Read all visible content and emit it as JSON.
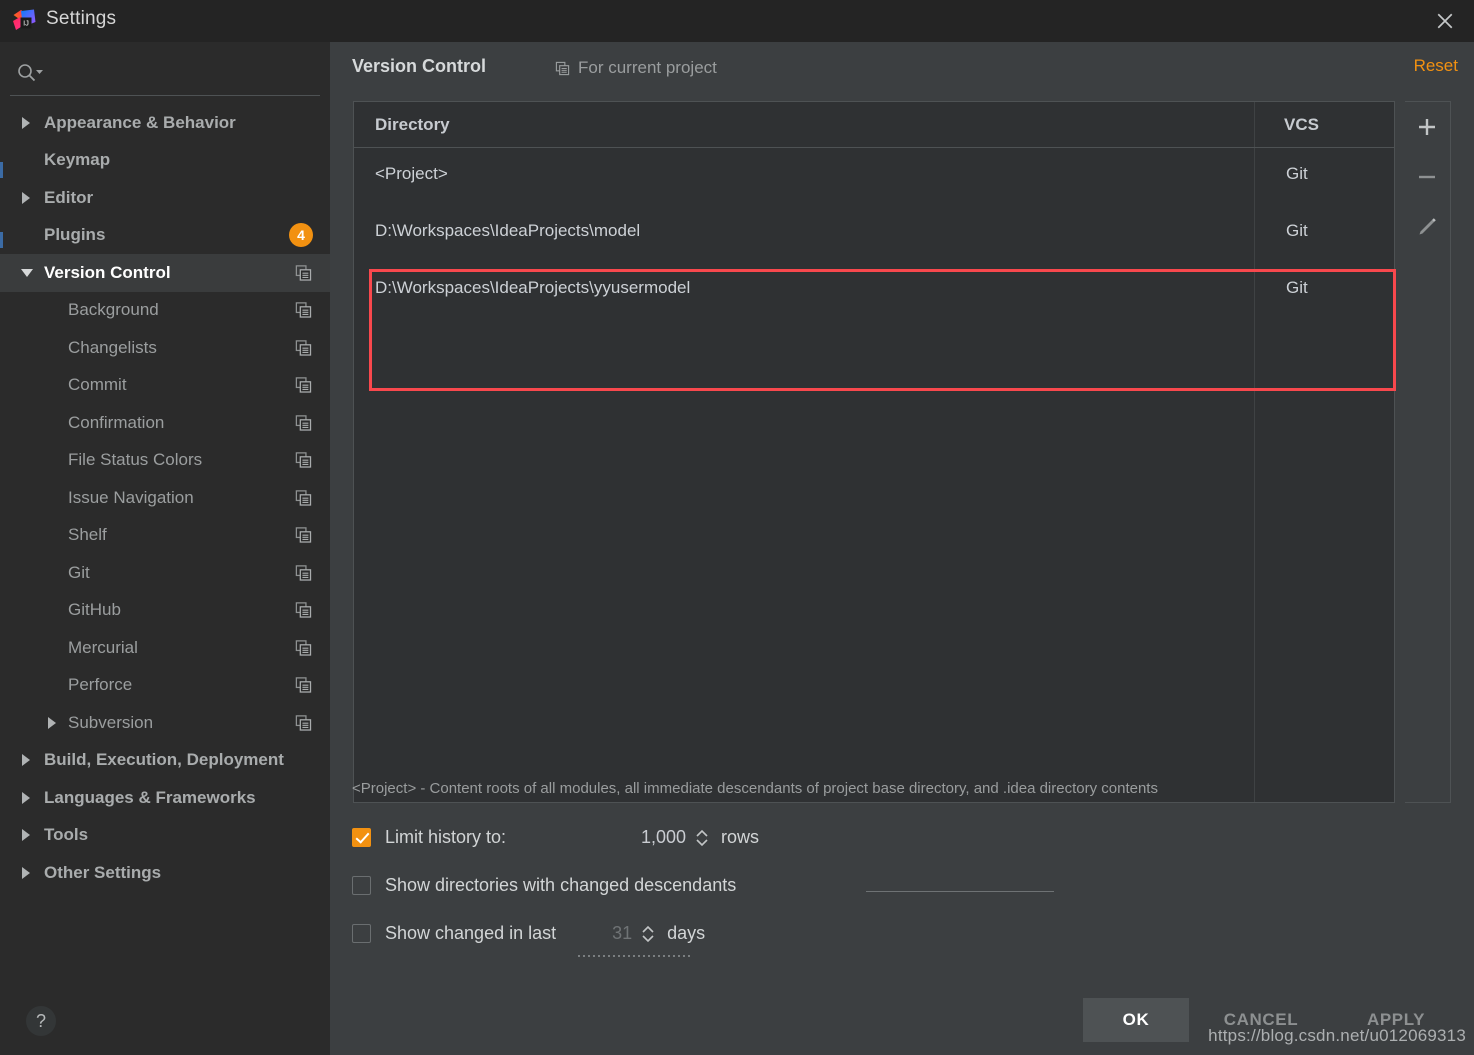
{
  "window": {
    "title": "Settings",
    "logo_icon": "intellij-idea-logo",
    "close_icon": "close-icon"
  },
  "sidebar": {
    "search": {
      "placeholder": "",
      "value": "",
      "icon": "search-icon",
      "dropdown_icon": "chevron-down-icon"
    },
    "items": [
      {
        "label": "Appearance & Behavior",
        "arrow": "right",
        "indent": 44,
        "bold": true,
        "copy_icon": false,
        "selected": false
      },
      {
        "label": "Keymap",
        "arrow": "none",
        "indent": 44,
        "bold": true,
        "copy_icon": false,
        "selected": false
      },
      {
        "label": "Editor",
        "arrow": "right",
        "indent": 44,
        "bold": true,
        "copy_icon": false,
        "selected": false
      },
      {
        "label": "Plugins",
        "arrow": "none",
        "indent": 44,
        "bold": true,
        "copy_icon": false,
        "selected": false,
        "badge": "4"
      },
      {
        "label": "Version Control",
        "arrow": "down",
        "indent": 44,
        "bold": true,
        "copy_icon": true,
        "selected": true
      },
      {
        "label": "Background",
        "arrow": "none",
        "indent": 68,
        "bold": false,
        "copy_icon": true,
        "selected": false
      },
      {
        "label": "Changelists",
        "arrow": "none",
        "indent": 68,
        "bold": false,
        "copy_icon": true,
        "selected": false
      },
      {
        "label": "Commit",
        "arrow": "none",
        "indent": 68,
        "bold": false,
        "copy_icon": true,
        "selected": false
      },
      {
        "label": "Confirmation",
        "arrow": "none",
        "indent": 68,
        "bold": false,
        "copy_icon": true,
        "selected": false
      },
      {
        "label": "File Status Colors",
        "arrow": "none",
        "indent": 68,
        "bold": false,
        "copy_icon": true,
        "selected": false
      },
      {
        "label": "Issue Navigation",
        "arrow": "none",
        "indent": 68,
        "bold": false,
        "copy_icon": true,
        "selected": false
      },
      {
        "label": "Shelf",
        "arrow": "none",
        "indent": 68,
        "bold": false,
        "copy_icon": true,
        "selected": false
      },
      {
        "label": "Git",
        "arrow": "none",
        "indent": 68,
        "bold": false,
        "copy_icon": true,
        "selected": false
      },
      {
        "label": "GitHub",
        "arrow": "none",
        "indent": 68,
        "bold": false,
        "copy_icon": true,
        "selected": false
      },
      {
        "label": "Mercurial",
        "arrow": "none",
        "indent": 68,
        "bold": false,
        "copy_icon": true,
        "selected": false
      },
      {
        "label": "Perforce",
        "arrow": "none",
        "indent": 68,
        "bold": false,
        "copy_icon": true,
        "selected": false
      },
      {
        "label": "Subversion",
        "arrow": "right-small",
        "indent": 68,
        "bold": false,
        "copy_icon": true,
        "selected": false
      },
      {
        "label": "Build, Execution, Deployment",
        "arrow": "right",
        "indent": 44,
        "bold": true,
        "copy_icon": false,
        "selected": false
      },
      {
        "label": "Languages & Frameworks",
        "arrow": "right",
        "indent": 44,
        "bold": true,
        "copy_icon": false,
        "selected": false
      },
      {
        "label": "Tools",
        "arrow": "right",
        "indent": 44,
        "bold": true,
        "copy_icon": false,
        "selected": false
      },
      {
        "label": "Other Settings",
        "arrow": "right",
        "indent": 44,
        "bold": true,
        "copy_icon": false,
        "selected": false
      }
    ]
  },
  "main": {
    "title": "Version Control",
    "scope_label": "For current project",
    "scope_icon": "copy-icon",
    "reset_label": "Reset",
    "table": {
      "columns": [
        "Directory",
        "VCS"
      ],
      "rows": [
        {
          "directory": "<Project>",
          "vcs": "Git",
          "highlighted": false
        },
        {
          "directory": "D:\\Workspaces\\IdeaProjects\\model",
          "vcs": "Git",
          "highlighted": true
        },
        {
          "directory": "D:\\Workspaces\\IdeaProjects\\yyusermodel",
          "vcs": "Git",
          "highlighted": true
        }
      ]
    },
    "tools": [
      {
        "name": "add-button",
        "icon": "plus-icon"
      },
      {
        "name": "remove-button",
        "icon": "minus-icon"
      },
      {
        "name": "edit-button",
        "icon": "pencil-icon"
      }
    ],
    "hint": "<Project> - Content roots of all modules, all immediate descendants of project base directory, and .idea directory contents",
    "options": {
      "limit_history": {
        "label": "Limit history to:",
        "checked": true,
        "value": "1,000",
        "unit": "rows"
      },
      "show_directories": {
        "label": "Show directories with changed descendants",
        "checked": false
      },
      "show_changed_last": {
        "label": "Show changed in last",
        "checked": false,
        "value": "31",
        "unit": "days"
      }
    }
  },
  "footer": {
    "help_label": "?",
    "ok_label": "OK",
    "cancel_label": "CANCEL",
    "apply_label": "APPLY",
    "watermark": "https://blog.csdn.net/u012069313"
  },
  "colors": {
    "accent": "#f29111",
    "highlight_box": "#f8484d",
    "window_bg": "#3c3f41",
    "sidebar_bg": "#2b2b2b"
  }
}
